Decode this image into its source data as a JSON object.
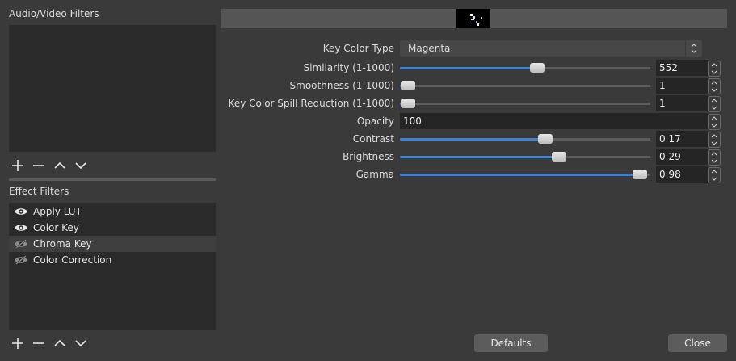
{
  "left_panel": {
    "av_filters_label": "Audio/Video Filters",
    "effect_filters_label": "Effect Filters",
    "effect_filters": [
      {
        "label": "Apply LUT",
        "visible": true,
        "selected": false
      },
      {
        "label": "Color Key",
        "visible": true,
        "selected": false
      },
      {
        "label": "Chroma Key",
        "visible": false,
        "selected": true
      },
      {
        "label": "Color Correction",
        "visible": false,
        "selected": false
      }
    ],
    "toolbar_icons": [
      "plus-icon",
      "minus-icon",
      "chevron-up-icon",
      "chevron-down-icon"
    ]
  },
  "properties": {
    "key_color_type": {
      "label": "Key Color Type",
      "value": "Magenta"
    },
    "similarity": {
      "label": "Similarity (1-1000)",
      "value": "552",
      "fraction": 0.552
    },
    "smoothness": {
      "label": "Smoothness (1-1000)",
      "value": "1",
      "fraction": 0.0
    },
    "spill_reduction": {
      "label": "Key Color Spill Reduction (1-1000)",
      "value": "1",
      "fraction": 0.0
    },
    "opacity": {
      "label": "Opacity",
      "value": "100"
    },
    "contrast": {
      "label": "Contrast",
      "value": "0.17",
      "fraction": 0.585
    },
    "brightness": {
      "label": "Brightness",
      "value": "0.29",
      "fraction": 0.645
    },
    "gamma": {
      "label": "Gamma",
      "value": "0.98",
      "fraction": 0.99
    }
  },
  "buttons": {
    "defaults": "Defaults",
    "close": "Close"
  },
  "colors": {
    "accent": "#3d82d6",
    "background": "#3a3a3a",
    "field": "#252525"
  }
}
